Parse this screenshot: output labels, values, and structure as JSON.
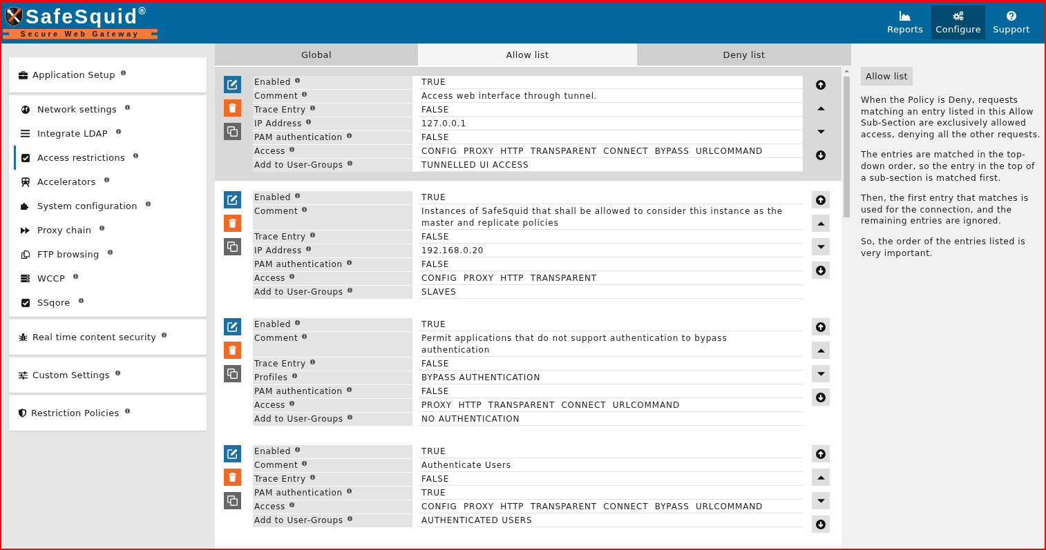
{
  "header": {
    "logo": {
      "name": "SafeSquid$^{®}$",
      "tagline": "Secure Web Gateway"
    },
    "nav": [
      {
        "label": "Reports",
        "selected": false
      },
      {
        "label": "Configure",
        "selected": true
      },
      {
        "label": "Support",
        "selected": false
      }
    ]
  },
  "sidebar": {
    "sections": [
      {
        "label": "Application Setup",
        "children": [
          {
            "label": "Network settings",
            "selected": false
          },
          {
            "label": "Integrate LDAP",
            "selected": false
          },
          {
            "label": "Access restrictions",
            "selected": true
          },
          {
            "label": "Accelerators",
            "selected": false
          },
          {
            "label": "System configuration",
            "selected": false
          },
          {
            "label": "Proxy chain",
            "selected": false
          },
          {
            "label": "FTP browsing",
            "selected": false
          },
          {
            "label": "WCCP",
            "selected": false
          },
          {
            "label": "SSqore",
            "selected": false
          }
        ]
      },
      {
        "label": "Real time content security"
      },
      {
        "label": "Custom Settings"
      },
      {
        "label": "Restriction Policies"
      }
    ]
  },
  "tabs": [
    {
      "label": "Global",
      "selected": false
    },
    {
      "label": "Allow list",
      "selected": true
    },
    {
      "label": "Deny list",
      "selected": false
    }
  ],
  "entries": [
    {
      "selected": true,
      "fields": [
        {
          "label": "Enabled",
          "value": "TRUE"
        },
        {
          "label": "Comment",
          "value": "Access web interface through tunnel."
        },
        {
          "label": "Trace Entry",
          "value": "FALSE"
        },
        {
          "label": "IP Address",
          "value": "127.0.0.1"
        },
        {
          "label": "PAM authentication",
          "value": "FALSE"
        },
        {
          "label": "Access",
          "value": "CONFIG  PROXY  HTTP  TRANSPARENT  CONNECT  BYPASS  URLCOMMAND"
        },
        {
          "label": "Add to User-Groups",
          "value": "TUNNELLED UI ACCESS"
        }
      ]
    },
    {
      "selected": false,
      "fields": [
        {
          "label": "Enabled",
          "value": "TRUE"
        },
        {
          "label": "Comment",
          "value": "Instances of SafeSquid that shall be allowed to consider this instance as the master and replicate policies"
        },
        {
          "label": "Trace Entry",
          "value": "FALSE"
        },
        {
          "label": "IP Address",
          "value": "192.168.0.20"
        },
        {
          "label": "PAM authentication",
          "value": "FALSE"
        },
        {
          "label": "Access",
          "value": "CONFIG  PROXY  HTTP  TRANSPARENT"
        },
        {
          "label": "Add to User-Groups",
          "value": "SLAVES"
        }
      ]
    },
    {
      "selected": false,
      "fields": [
        {
          "label": "Enabled",
          "value": "TRUE"
        },
        {
          "label": "Comment",
          "value": "Permit applications that do not support authentication to bypass authentication"
        },
        {
          "label": "Trace Entry",
          "value": "FALSE"
        },
        {
          "label": "Profiles",
          "value": "BYPASS AUTHENTICATION"
        },
        {
          "label": "PAM authentication",
          "value": "FALSE"
        },
        {
          "label": "Access",
          "value": "PROXY  HTTP  TRANSPARENT  CONNECT  URLCOMMAND"
        },
        {
          "label": "Add to User-Groups",
          "value": "NO AUTHENTICATION"
        }
      ]
    },
    {
      "selected": false,
      "fields": [
        {
          "label": "Enabled",
          "value": "TRUE"
        },
        {
          "label": "Comment",
          "value": "Authenticate Users"
        },
        {
          "label": "Trace Entry",
          "value": "FALSE"
        },
        {
          "label": "PAM authentication",
          "value": "TRUE"
        },
        {
          "label": "Access",
          "value": "CONFIG  PROXY  HTTP  TRANSPARENT  CONNECT  BYPASS  URLCOMMAND"
        },
        {
          "label": "Add to User-Groups",
          "value": "AUTHENTICATED USERS"
        }
      ]
    }
  ],
  "help": {
    "title": "Allow list",
    "paragraphs": [
      "When the Policy is Deny, requests matching an entry listed in this Allow Sub-Section are exclusively allowed access, denying all the other requests.",
      "The entries are matched in the top-down order, so the entry in the top of a sub-section is matched first.",
      "Then, the first entry that matches is used for the connection, and the remaining entries are ignored.",
      "So, the order of the entries listed is very important."
    ]
  }
}
